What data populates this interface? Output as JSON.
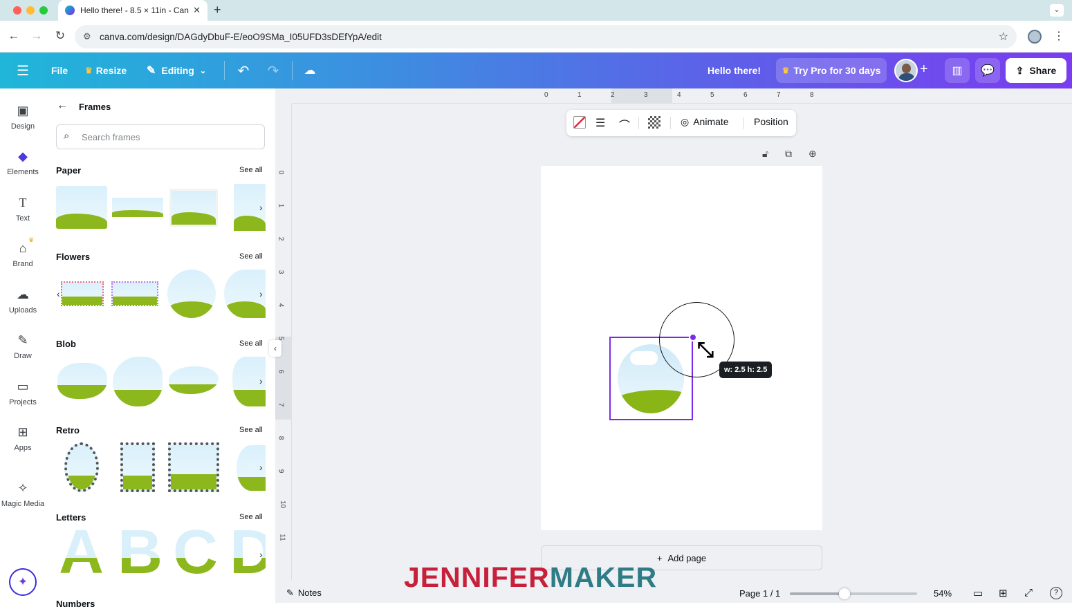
{
  "browser": {
    "tab_title": "Hello there! - 8.5 × 11in - Can",
    "url": "canva.com/design/DAGdyDbuF-E/eoO9SMa_I05UFD3sDEfYpA/edit"
  },
  "header": {
    "file": "File",
    "resize": "Resize",
    "editing": "Editing",
    "doc_title": "Hello there!",
    "try_pro": "Try Pro for 30 days",
    "share": "Share"
  },
  "rail": {
    "items": [
      {
        "label": "Design",
        "icon": "layout-icon"
      },
      {
        "label": "Elements",
        "icon": "shapes-icon"
      },
      {
        "label": "Text",
        "icon": "text-icon"
      },
      {
        "label": "Brand",
        "icon": "brand-icon"
      },
      {
        "label": "Uploads",
        "icon": "cloud-upload-icon"
      },
      {
        "label": "Draw",
        "icon": "pen-icon"
      },
      {
        "label": "Projects",
        "icon": "folder-icon"
      },
      {
        "label": "Apps",
        "icon": "apps-icon"
      },
      {
        "label": "Magic Media",
        "icon": "magic-media-icon"
      }
    ]
  },
  "panel": {
    "title": "Frames",
    "search_placeholder": "Search frames",
    "see_all": "See all",
    "sections": [
      "Paper",
      "Flowers",
      "Blob",
      "Retro",
      "Letters",
      "Numbers"
    ],
    "letters": [
      "A",
      "B",
      "C",
      "D"
    ]
  },
  "ruler": {
    "h": [
      "0",
      "1",
      "2",
      "3",
      "4",
      "5",
      "6",
      "7",
      "8"
    ],
    "v": [
      "0",
      "1",
      "2",
      "3",
      "4",
      "5",
      "6",
      "7",
      "8",
      "9",
      "10",
      "11"
    ]
  },
  "context_toolbar": {
    "animate": "Animate",
    "position": "Position"
  },
  "canvas": {
    "size_tooltip": "w: 2.5 h: 2.5",
    "add_page": "Add page"
  },
  "footer": {
    "notes": "Notes",
    "page": "Page 1 / 1",
    "zoom": "54%",
    "zoom_level": 0.54
  },
  "watermark": {
    "part1": "JENNIFER",
    "part2": "MAKER",
    "color1": "#c6203a",
    "color2": "#2f7c86"
  },
  "colors": {
    "selection": "#7d2ae8",
    "header_start": "#1fb6d9",
    "header_end": "#7a3cf0"
  }
}
